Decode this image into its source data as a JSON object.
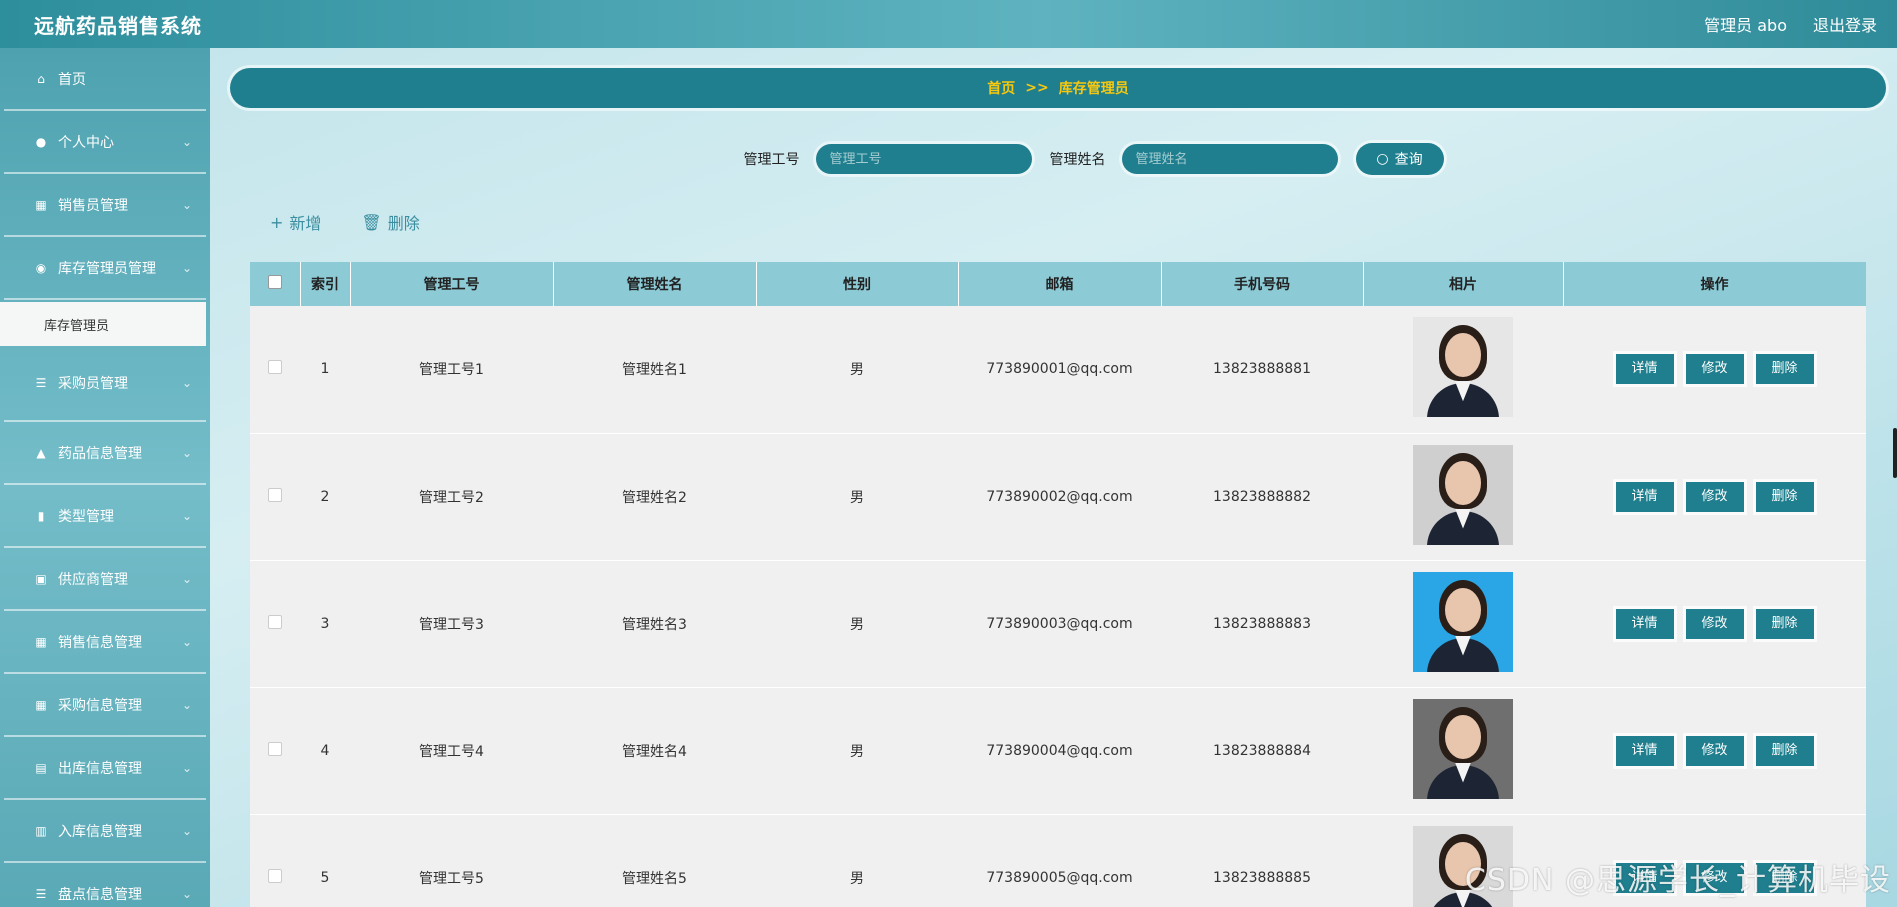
{
  "header": {
    "title": "远航药品销售系统",
    "user_label": "管理员 abo",
    "logout_label": "退出登录"
  },
  "sidebar": {
    "items": [
      {
        "label": "首页",
        "icon": "home-icon",
        "glyph": "⌂",
        "chevron": false
      },
      {
        "label": "个人中心",
        "icon": "user-icon",
        "glyph": "●",
        "chevron": true
      },
      {
        "label": "销售员管理",
        "icon": "grid-icon",
        "glyph": "▦",
        "chevron": true
      },
      {
        "label": "库存管理员管理",
        "icon": "pin-icon",
        "glyph": "◉",
        "chevron": true
      },
      {
        "label": "采购员管理",
        "icon": "list-icon",
        "glyph": "☰",
        "chevron": true
      },
      {
        "label": "药品信息管理",
        "icon": "thumb-icon",
        "glyph": "▲",
        "chevron": true
      },
      {
        "label": "类型管理",
        "icon": "chart-icon",
        "glyph": "▮",
        "chevron": true
      },
      {
        "label": "供应商管理",
        "icon": "briefcase-icon",
        "glyph": "▣",
        "chevron": true
      },
      {
        "label": "销售信息管理",
        "icon": "grid-icon",
        "glyph": "▦",
        "chevron": true
      },
      {
        "label": "采购信息管理",
        "icon": "grid-icon",
        "glyph": "▦",
        "chevron": true
      },
      {
        "label": "出库信息管理",
        "icon": "document-icon",
        "glyph": "▤",
        "chevron": true
      },
      {
        "label": "入库信息管理",
        "icon": "clipboard-icon",
        "glyph": "▥",
        "chevron": true
      },
      {
        "label": "盘点信息管理",
        "icon": "list-icon",
        "glyph": "☰",
        "chevron": true
      }
    ],
    "submenu": {
      "label": "库存管理员"
    }
  },
  "breadcrumb": {
    "home": "首页",
    "separator": ">>",
    "current": "库存管理员"
  },
  "search": {
    "field1_label": "管理工号",
    "field1_placeholder": "管理工号",
    "field2_label": "管理姓名",
    "field2_placeholder": "管理姓名",
    "button_label": "查询"
  },
  "actions": {
    "add_label": "新增",
    "delete_label": "删除"
  },
  "table": {
    "columns": [
      "索引",
      "管理工号",
      "管理姓名",
      "性别",
      "邮箱",
      "手机号码",
      "相片",
      "操作"
    ],
    "rows": [
      {
        "index": "1",
        "id": "管理工号1",
        "name": "管理姓名1",
        "gender": "男",
        "email": "773890001@qq.com",
        "phone": "13823888881"
      },
      {
        "index": "2",
        "id": "管理工号2",
        "name": "管理姓名2",
        "gender": "男",
        "email": "773890002@qq.com",
        "phone": "13823888882"
      },
      {
        "index": "3",
        "id": "管理工号3",
        "name": "管理姓名3",
        "gender": "男",
        "email": "773890003@qq.com",
        "phone": "13823888883"
      },
      {
        "index": "4",
        "id": "管理工号4",
        "name": "管理姓名4",
        "gender": "男",
        "email": "773890004@qq.com",
        "phone": "13823888884"
      },
      {
        "index": "5",
        "id": "管理工号5",
        "name": "管理姓名5",
        "gender": "男",
        "email": "773890005@qq.com",
        "phone": "13823888885"
      }
    ],
    "op_labels": {
      "detail": "详情",
      "edit": "修改",
      "delete": "删除"
    }
  },
  "photo_backgrounds": [
    "#e6e6e6",
    "#cfcfcf",
    "#2aa6e6",
    "#6f6f6f",
    "#d9d9d9"
  ],
  "watermark": "CSDN @思源学长_计算机毕设"
}
